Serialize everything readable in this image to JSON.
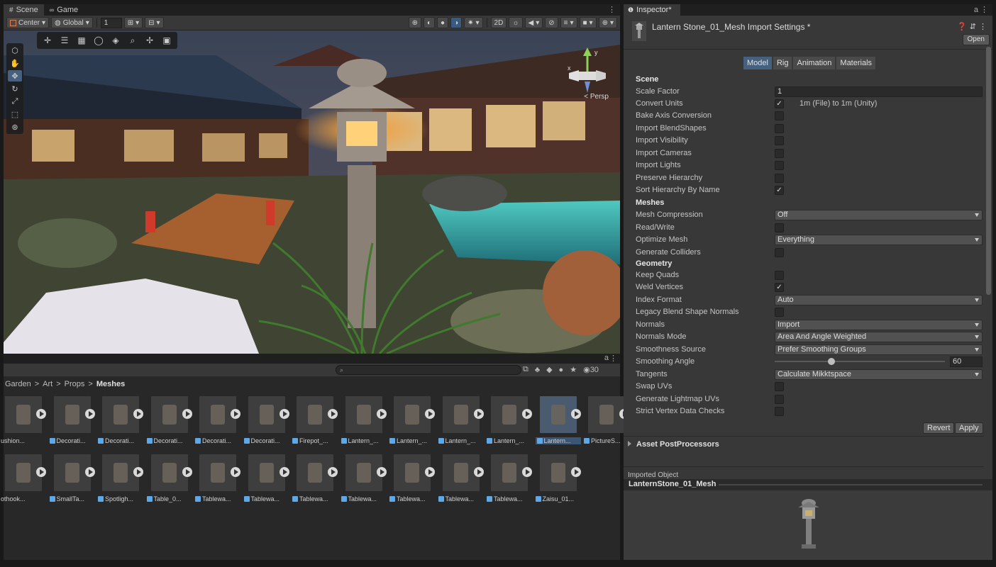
{
  "scene_panel": {
    "tabs": [
      {
        "label": "Scene",
        "icon": "grid-icon"
      },
      {
        "label": "Game",
        "icon": "gamepad-icon"
      }
    ],
    "toolbar": {
      "pivot_label": "Center",
      "space_label": "Global",
      "snap_value": "1",
      "mode_2d_label": "2D"
    },
    "view": {
      "perspective_label": "< Persp",
      "gizmo_axes": {
        "y": "y",
        "x": "x"
      }
    }
  },
  "project_panel": {
    "search_placeholder": "",
    "visible_count": "30",
    "breadcrumb": {
      "parts": [
        "Garden",
        "Art",
        "Props"
      ],
      "current": "Meshes",
      "separator": ">"
    },
    "assets_row1": [
      "ushion...",
      "Decorati...",
      "Decorati...",
      "Decorati...",
      "Decorati...",
      "Decorati...",
      "Firepot_...",
      "Lantern_...",
      "Lantern_...",
      "Lantern_...",
      "Lantern_...",
      "Lantern...",
      "PictureS..."
    ],
    "assets_row2": [
      "othook...",
      "SmallTa...",
      "Spotligh...",
      "Table_0...",
      "Tablewa...",
      "Tablewa...",
      "Tablewa...",
      "Tablewa...",
      "Tablewa...",
      "Tablewa...",
      "Tablewa...",
      "Zaisu_01..."
    ],
    "selected_index": 11
  },
  "inspector": {
    "tab_label": "Inspector*",
    "title": "Lantern Stone_01_Mesh Import Settings *",
    "open_label": "Open",
    "subtabs": [
      "Model",
      "Rig",
      "Animation",
      "Materials"
    ],
    "active_subtab": "Model",
    "scene": {
      "header": "Scene",
      "scale_factor_label": "Scale Factor",
      "scale_factor_value": "1",
      "convert_units_label": "Convert Units",
      "convert_units_checked": true,
      "convert_units_note": "1m (File) to 1m (Unity)",
      "bake_axis_label": "Bake Axis Conversion",
      "import_blendshapes_label": "Import BlendShapes",
      "import_visibility_label": "Import Visibility",
      "import_cameras_label": "Import Cameras",
      "import_lights_label": "Import Lights",
      "preserve_hierarchy_label": "Preserve Hierarchy",
      "sort_hierarchy_label": "Sort Hierarchy By Name",
      "sort_hierarchy_checked": true
    },
    "meshes": {
      "header": "Meshes",
      "mesh_compression_label": "Mesh Compression",
      "mesh_compression_value": "Off",
      "read_write_label": "Read/Write",
      "optimize_mesh_label": "Optimize Mesh",
      "optimize_mesh_value": "Everything",
      "generate_colliders_label": "Generate Colliders"
    },
    "geometry": {
      "header": "Geometry",
      "keep_quads_label": "Keep Quads",
      "weld_vertices_label": "Weld Vertices",
      "weld_vertices_checked": true,
      "index_format_label": "Index Format",
      "index_format_value": "Auto",
      "legacy_blend_label": "Legacy Blend Shape Normals",
      "normals_label": "Normals",
      "normals_value": "Import",
      "normals_mode_label": "Normals Mode",
      "normals_mode_value": "Area And Angle Weighted",
      "smoothness_source_label": "Smoothness Source",
      "smoothness_source_value": "Prefer Smoothing Groups",
      "smoothing_angle_label": "Smoothing Angle",
      "smoothing_angle_value": "60",
      "smoothing_angle_fraction": 0.333,
      "tangents_label": "Tangents",
      "tangents_value": "Calculate Mikktspace",
      "swap_uvs_label": "Swap UVs",
      "generate_lightmap_label": "Generate Lightmap UVs",
      "strict_vertex_label": "Strict Vertex Data Checks"
    },
    "revert_label": "Revert",
    "apply_label": "Apply",
    "asset_postprocessors_label": "Asset PostProcessors",
    "imported_object_label": "Imported Object",
    "preview_title": "LanternStone_01_Mesh"
  },
  "colors": {
    "accent": "#46607f",
    "panel_bg": "#383838",
    "dark_bg": "#282828"
  }
}
